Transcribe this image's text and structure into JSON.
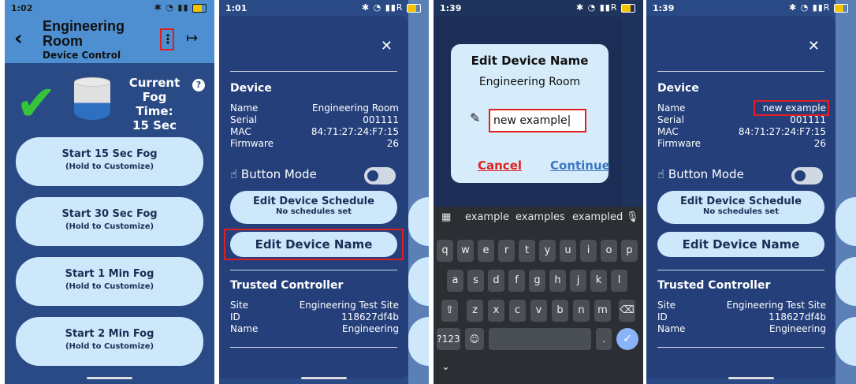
{
  "p1": {
    "time": "1:02",
    "title_line1": "Engineering",
    "title_line2": "Room",
    "subtitle": "Device Control",
    "fog_label": "Current Fog Time:",
    "fog_value": "15 Sec",
    "buttons": [
      {
        "title": "Start 15 Sec Fog",
        "sub": "(Hold to Customize)"
      },
      {
        "title": "Start 30 Sec Fog",
        "sub": "(Hold to Customize)"
      },
      {
        "title": "Start 1 Min Fog",
        "sub": "(Hold to Customize)"
      },
      {
        "title": "Start 2 Min Fog",
        "sub": "(Hold to Customize)"
      }
    ]
  },
  "sheet": {
    "time2": "1:01",
    "time4": "1:39",
    "device_heading": "Device",
    "rows": {
      "name_k": "Name",
      "name_v": "Engineering Room",
      "name_v_new": "new example",
      "serial_k": "Serial",
      "serial_v": "001111",
      "mac_k": "MAC",
      "mac_v": "84:71:27:24:F7:15",
      "fw_k": "Firmware",
      "fw_v": "26"
    },
    "button_mode": "Button Mode",
    "schedule_title": "Edit Device Schedule",
    "schedule_sub": "No schedules set",
    "edit_name": "Edit Device Name",
    "trusted_heading": "Trusted Controller",
    "tc": {
      "site_k": "Site",
      "site_v": "Engineering Test Site",
      "id_k": "ID",
      "id_v": "118627df4b",
      "name_k": "Name",
      "name_v": "Engineering"
    }
  },
  "dialog": {
    "time": "1:39",
    "title": "Edit Device Name",
    "current": "Engineering Room",
    "input_value": "new example",
    "cancel": "Cancel",
    "continue": "Continue"
  },
  "keyboard": {
    "suggestions": [
      "example",
      "examples",
      "exampled"
    ],
    "row1": [
      "q",
      "w",
      "e",
      "r",
      "t",
      "y",
      "u",
      "i",
      "o",
      "p"
    ],
    "row2": [
      "a",
      "s",
      "d",
      "f",
      "g",
      "h",
      "j",
      "k",
      "l"
    ],
    "row3": [
      "z",
      "x",
      "c",
      "v",
      "b",
      "n",
      "m"
    ],
    "sym": "?123"
  },
  "colors": {
    "accent": "#4d8fd1",
    "sheet": "#243f7a",
    "pill": "#cde7fb",
    "highlight": "#e02020"
  }
}
